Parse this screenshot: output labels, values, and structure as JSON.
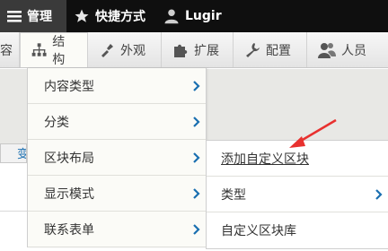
{
  "toolbar": {
    "manage": "管理",
    "shortcuts": "快捷方式",
    "user": "Lugir"
  },
  "tray": {
    "first_partial": "容",
    "structure": "结构",
    "appearance": "外观",
    "extend": "扩展",
    "config": "配置",
    "people": "人员"
  },
  "page": {
    "tab_partial": "变"
  },
  "menu": {
    "items": [
      {
        "label": "内容类型"
      },
      {
        "label": "分类"
      },
      {
        "label": "区块布局"
      },
      {
        "label": "显示模式"
      },
      {
        "label": "联系表单"
      }
    ]
  },
  "submenu": {
    "items": [
      {
        "label": "添加自定义区块"
      },
      {
        "label": "类型"
      },
      {
        "label": "自定义区块库"
      }
    ]
  },
  "colors": {
    "chevron": "#1a6fb0",
    "arrow": "#e8312f",
    "toolbar_bg": "#0f0f0f"
  }
}
